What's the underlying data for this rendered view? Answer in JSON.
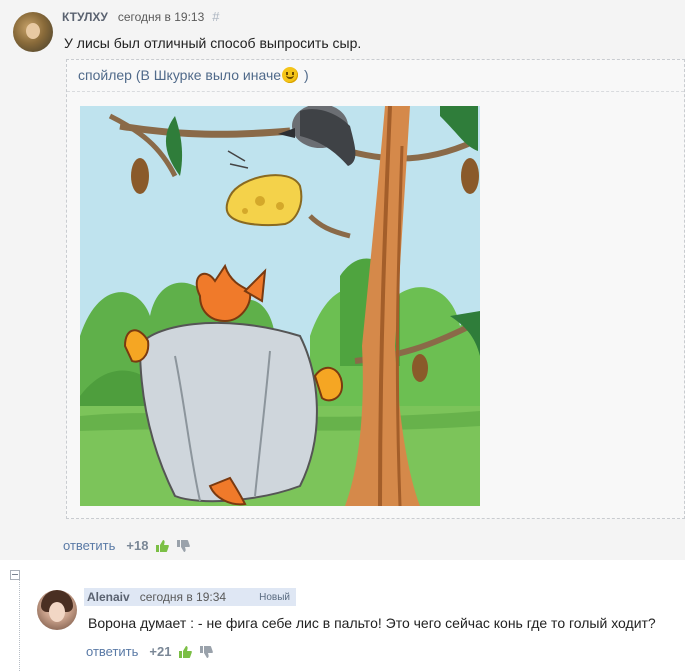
{
  "comment1": {
    "author": "КТУЛХУ",
    "time": "сегодня в 19:13",
    "hash": "#",
    "text": "У лисы был отличный способ выпросить сыр.",
    "spoiler": {
      "label_before": "спойлер (В Шкурке выло иначе",
      "label_after": ")"
    },
    "reply_label": "ответить",
    "score": "+18"
  },
  "comment2": {
    "author": "Alenaiv",
    "time": "сегодня в 19:34",
    "badge": "Новый",
    "text": "Ворона думает : - не фига себе лис в пальто! Это чего сейчас конь где то голый ходит?",
    "reply_label": "ответить",
    "score": "+21"
  },
  "icons": [
    "hash-link-icon",
    "smiley-icon",
    "thumbs-up-icon",
    "thumbs-down-icon",
    "collapse-minus-icon"
  ],
  "colors": {
    "link": "#5a7aa6",
    "thumbs_up": "#7bbf45",
    "thumbs_down": "#9aa2ab",
    "new_header": "#dfe7f4",
    "comment_bg": "#f4f4f4"
  }
}
